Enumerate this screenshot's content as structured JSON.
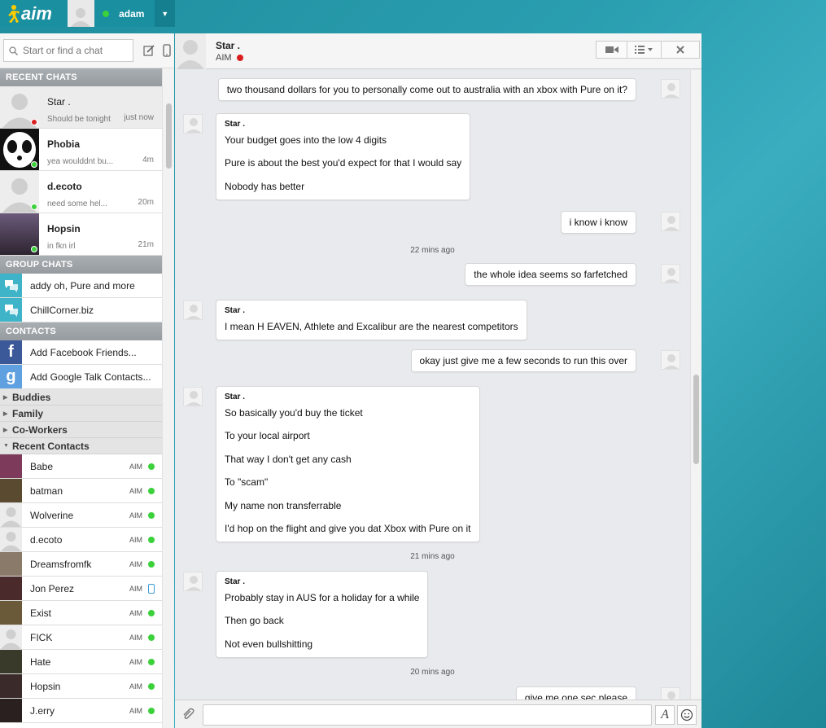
{
  "app": {
    "logo": "aim",
    "user_name": "adam"
  },
  "search": {
    "placeholder": "Start or find a chat"
  },
  "sections": {
    "recent": "RECENT CHATS",
    "group": "GROUP CHATS",
    "contacts": "CONTACTS"
  },
  "recent_chats": [
    {
      "name": "Star .",
      "msg": "Should be tonight",
      "time": "just now",
      "status": "#d81e1e"
    },
    {
      "name": "Phobia",
      "msg": "yea woulddnt bu...",
      "time": "4m",
      "status": "#3bd13b"
    },
    {
      "name": "d.ecoto",
      "msg": "need some hel...",
      "time": "20m",
      "status": "#3bd13b"
    },
    {
      "name": "Hopsin",
      "msg": "in fkn irl",
      "time": "21m",
      "status": "#3bd13b"
    }
  ],
  "group_chats": [
    {
      "label": "addy oh, Pure and more"
    },
    {
      "label": "ChillCorner.biz"
    }
  ],
  "contact_links": [
    {
      "label": "Add Facebook Friends..."
    },
    {
      "label": "Add Google Talk Contacts..."
    }
  ],
  "categories": [
    "Buddies",
    "Family",
    "Co-Workers",
    "Recent Contacts"
  ],
  "contacts": [
    {
      "name": "Babe",
      "net": "AIM"
    },
    {
      "name": "batman",
      "net": "AIM"
    },
    {
      "name": "Wolverine",
      "net": "AIM"
    },
    {
      "name": "d.ecoto",
      "net": "AIM"
    },
    {
      "name": "Dreamsfromfk",
      "net": "AIM"
    },
    {
      "name": "Jon Perez",
      "net": "AIM"
    },
    {
      "name": "Exist",
      "net": "AIM"
    },
    {
      "name": "FICK",
      "net": "AIM"
    },
    {
      "name": "Hate",
      "net": "AIM"
    },
    {
      "name": "Hopsin",
      "net": "AIM"
    },
    {
      "name": "J.erry",
      "net": "AIM"
    }
  ],
  "chat": {
    "name": "Star .",
    "network": "AIM",
    "messages": [
      {
        "dir": "out",
        "text": "two thousand dollars for you to personally come out to australia with an xbox with Pure on it?"
      },
      {
        "dir": "in",
        "who": "Star .",
        "lines": [
          "Your budget goes into the low 4 digits",
          "Pure is about the best you'd expect for that I would say",
          "Nobody has better"
        ]
      },
      {
        "dir": "out",
        "text": "i know i know"
      },
      {
        "stamp": "22 mins ago"
      },
      {
        "dir": "out",
        "text": "the whole idea seems so farfetched"
      },
      {
        "dir": "in",
        "who": "Star .",
        "lines": [
          "I mean H EAVEN, Athlete and Excalibur are the nearest competitors"
        ]
      },
      {
        "dir": "out",
        "text": "okay just give me a few seconds to run this over"
      },
      {
        "dir": "in",
        "who": "Star .",
        "lines": [
          "So basically you'd buy the ticket",
          "To your local airport",
          "That way I don't get any cash",
          "To \"scam\"",
          "My name non transferrable",
          "I'd hop on the flight and give you dat Xbox with Pure on it"
        ]
      },
      {
        "stamp": "21 mins ago"
      },
      {
        "dir": "in",
        "who": "Star .",
        "lines": [
          "Probably stay in AUS for a holiday for a while",
          "Then go back",
          "Not even bullshitting"
        ]
      },
      {
        "stamp": "20 mins ago"
      },
      {
        "dir": "out",
        "text": "give me one sec please"
      }
    ]
  },
  "colors": {
    "accent": "#1a8fa0",
    "online": "#3bd13b",
    "away": "#d81e1e"
  }
}
